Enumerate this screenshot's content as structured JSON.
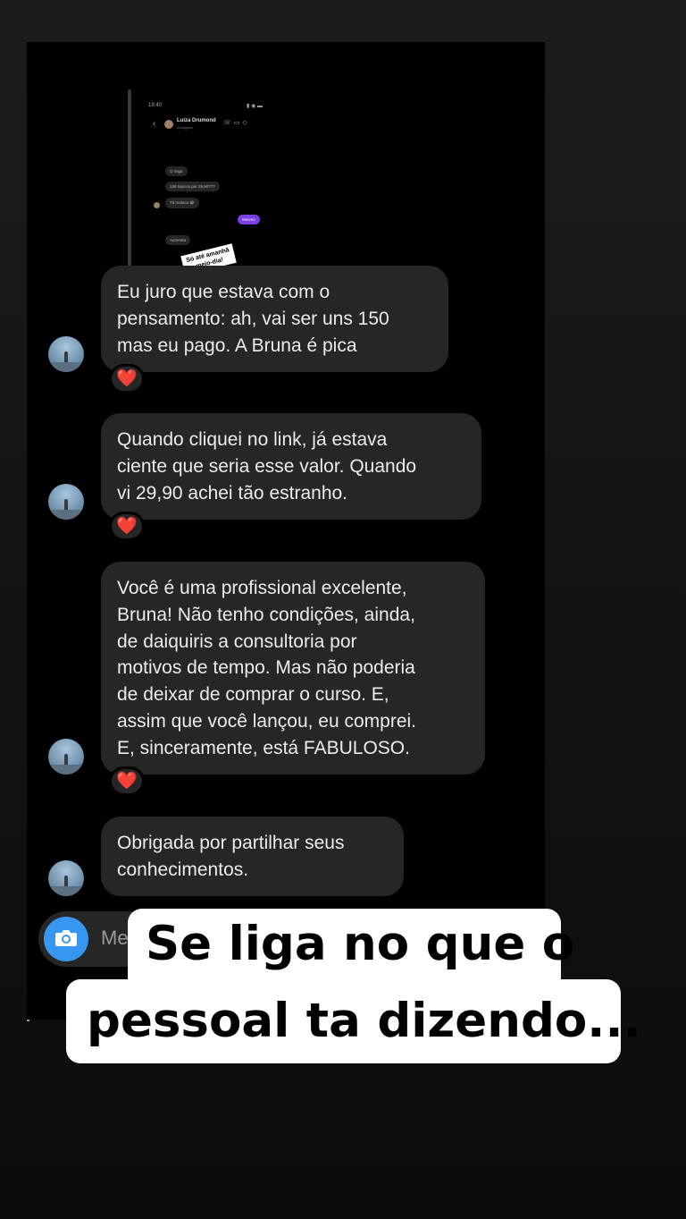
{
  "shared_story": {
    "time": "19:40",
    "contact_name": "Luiza Drumond",
    "contact_sub": "Instagram",
    "messages": [
      {
        "text": "O miga"
      },
      {
        "text": "128 tópicos por 29,90???"
      },
      {
        "text": "Tá maluca 😂"
      },
      {
        "text": "Mesmo",
        "sent": true
      },
      {
        "text": "Aumenta"
      }
    ],
    "sticker_line1": "Só até amanhã",
    "sticker_line2": "meio-dia!"
  },
  "messages": [
    {
      "text": "Eu juro que estava com o\npensamento: ah, vai ser uns 150\nmas eu pago. A Bruna é pica",
      "reaction": "❤️"
    },
    {
      "text": "Quando cliquei no link, já estava\nciente que seria esse valor. Quando\nvi 29,90 achei tão estranho.",
      "reaction": "❤️"
    },
    {
      "text": "Você é uma profissional excelente,\nBruna! Não tenho condições, ainda,\nde daiquiris a consultoria por\nmotivos de tempo. Mas não poderia\nde deixar de comprar o curso. E,\nassim que você lançou, eu comprei.\nE, sinceramente, está FABULOSO.",
      "reaction": "❤️"
    },
    {
      "text": "Obrigada por partilhar seus\nconhecimentos."
    }
  ],
  "composer": {
    "placeholder": "Me",
    "camera_icon": "camera-icon"
  },
  "caption": {
    "line1": "Se liga no que o",
    "line2": "pessoal ta dizendo..."
  }
}
